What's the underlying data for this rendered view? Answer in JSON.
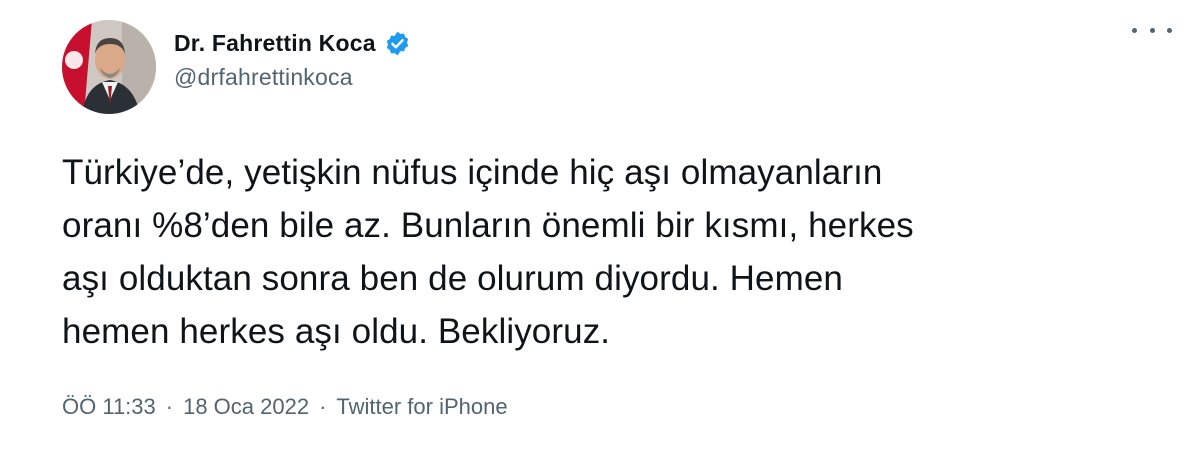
{
  "author": {
    "display_name": "Dr. Fahrettin Koca",
    "handle": "@drfahrettinkoca",
    "verified": true,
    "avatar_icon": "profile-photo"
  },
  "tweet": {
    "text": "Türkiye’de, yetişkin nüfus içinde hiç aşı olmayanların\noranı %8’den bile az. Bunların önemli bir kısmı, herkes\naşı olduktan sonra ben de olurum diyordu. Hemen\nhemen herkes aşı oldu. Bekliyoruz.",
    "time": "ÖÖ 11:33",
    "separator": "·",
    "date": "18 Oca 2022",
    "source": "Twitter for iPhone"
  },
  "icons": {
    "more": "more-icon",
    "verified": "verified-badge-icon"
  },
  "colors": {
    "text": "#0f1419",
    "secondary": "#536471",
    "verified": "#1d9bf0"
  }
}
